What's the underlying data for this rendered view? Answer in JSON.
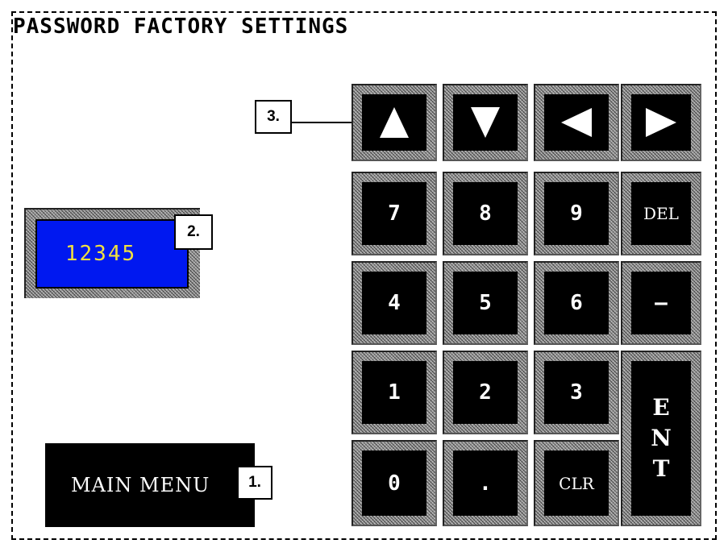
{
  "title": "PASSWORD FACTORY SETTINGS",
  "display": {
    "value": "12345"
  },
  "main_menu": {
    "label": "MAIN MENU"
  },
  "callouts": {
    "one": "1.",
    "two": "2.",
    "three": "3."
  },
  "keypad": {
    "up_icon": "up-arrow-icon",
    "down_icon": "down-arrow-icon",
    "left_icon": "left-arrow-icon",
    "right_icon": "right-arrow-icon",
    "k7": "7",
    "k8": "8",
    "k9": "9",
    "del": "DEL",
    "k4": "4",
    "k5": "5",
    "k6": "6",
    "minus": "—",
    "k1": "1",
    "k2": "2",
    "k3": "3",
    "k0": "0",
    "dot": ".",
    "clr": "CLR",
    "ent": [
      "E",
      "N",
      "T"
    ]
  },
  "colors": {
    "display_bg": "#0018f0",
    "display_text": "#f0e040",
    "key_face": "#000000",
    "key_label": "#ffffff"
  }
}
